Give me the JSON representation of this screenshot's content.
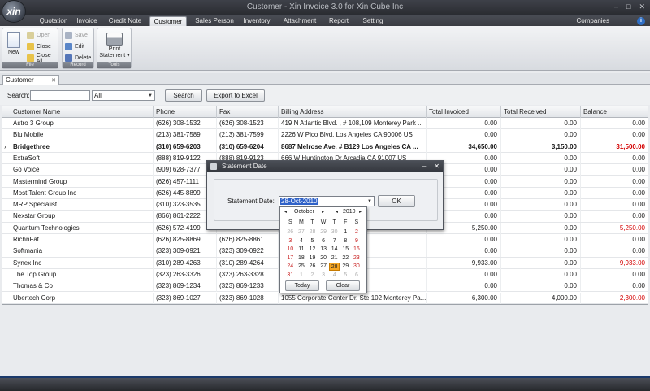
{
  "window": {
    "title": "Customer - Xin Invoice 3.0 for Xin Cube Inc",
    "app_orb_label": "xin",
    "controls": [
      "–",
      "□",
      "✕"
    ]
  },
  "ribbon_tabs": [
    "Quotation",
    "Invoice",
    "Credit Note",
    "Customer",
    "Sales Person",
    "Inventory",
    "Attachment",
    "Report",
    "Setting"
  ],
  "active_tab": "Customer",
  "companies_label": "Companies",
  "ribbon": {
    "file_group": {
      "caption": "File",
      "new": "New",
      "open": "Open",
      "close": "Close",
      "close_all": "Close All"
    },
    "record_group": {
      "caption": "Record",
      "save": "Save",
      "edit": "Edit",
      "delete": "Delete"
    },
    "tools_group": {
      "caption": "Tools",
      "print_line1": "Print",
      "print_line2": "Statement ▾"
    }
  },
  "doc_tab": {
    "label": "Customer",
    "close": "✕"
  },
  "search": {
    "label": "Search:",
    "value": "",
    "filter_value": "All",
    "search_button": "Search",
    "export_button": "Export to Excel"
  },
  "grid": {
    "columns": [
      "Customer Name",
      "Phone",
      "Fax",
      "Billing Address",
      "Total Invoiced",
      "Total Received",
      "Balance"
    ],
    "selected_indicator": "›",
    "rows": [
      {
        "name": "Astro 3 Group",
        "phone": "(626) 308-1532",
        "fax": "(626) 308-1523",
        "address": "419 N Atlantic Blvd. , # 108,109 Monterey Park ...",
        "invoiced": "0.00",
        "received": "0.00",
        "balance": "0.00",
        "neg": false
      },
      {
        "name": "Blu Mobile",
        "phone": "(213) 381-7589",
        "fax": "(213) 381-7599",
        "address": "2226 W Pico Blvd. Los Angeles CA 90006 US",
        "invoiced": "0.00",
        "received": "0.00",
        "balance": "0.00",
        "neg": false
      },
      {
        "name": "Bridgethree",
        "phone": "(310) 659-6203",
        "fax": "(310) 659-6204",
        "address": "8687 Melrose Ave. # B129 Los Angeles CA ...",
        "invoiced": "34,650.00",
        "received": "3,150.00",
        "balance": "31,500.00",
        "neg": true,
        "selected": true
      },
      {
        "name": "ExtraSoft",
        "phone": "(888) 819-9122",
        "fax": "(888) 819-9123",
        "address": "666 W Huntington Dr Arcadia CA 91007 US",
        "invoiced": "0.00",
        "received": "0.00",
        "balance": "0.00",
        "neg": false
      },
      {
        "name": "Go Voice",
        "phone": "(909) 628-7377",
        "fax": "",
        "address": "",
        "invoiced": "0.00",
        "received": "0.00",
        "balance": "0.00",
        "neg": false
      },
      {
        "name": "Mastermind Group",
        "phone": "(626) 457-1111",
        "fax": "",
        "address": "",
        "invoiced": "0.00",
        "received": "0.00",
        "balance": "0.00",
        "neg": false
      },
      {
        "name": "Most Talent Group Inc",
        "phone": "(626) 445-8899",
        "fax": "",
        "address": "",
        "invoiced": "0.00",
        "received": "0.00",
        "balance": "0.00",
        "neg": false
      },
      {
        "name": "MRP Specialist",
        "phone": "(310) 323-3535",
        "fax": "",
        "address": "",
        "invoiced": "0.00",
        "received": "0.00",
        "balance": "0.00",
        "neg": false
      },
      {
        "name": "Nexstar Group",
        "phone": "(866) 861-2222",
        "fax": "",
        "address": "",
        "invoiced": "0.00",
        "received": "0.00",
        "balance": "0.00",
        "neg": false
      },
      {
        "name": "Quantum Technologies",
        "phone": "(626) 572-4199",
        "fax": "",
        "address": "",
        "invoiced": "5,250.00",
        "received": "0.00",
        "balance": "5,250.00",
        "neg": true
      },
      {
        "name": "RichnFat",
        "phone": "(626) 825-8869",
        "fax": "(626) 825-8861",
        "address": "riel CA 91776 US",
        "invoiced": "0.00",
        "received": "0.00",
        "balance": "0.00",
        "neg": false
      },
      {
        "name": "Softmania",
        "phone": "(323) 309-0921",
        "fax": "(323) 309-0922",
        "address": "y Park, CA 91754...",
        "invoiced": "0.00",
        "received": "0.00",
        "balance": "0.00",
        "neg": false
      },
      {
        "name": "Synex Inc",
        "phone": "(310) 289-4263",
        "fax": "(310) 289-4264",
        "address": "A 91740 US",
        "invoiced": "9,933.00",
        "received": "0.00",
        "balance": "9,933.00",
        "neg": true
      },
      {
        "name": "The Top Group",
        "phone": "(323) 263-3326",
        "fax": "(323) 263-3328",
        "address": "El Monte CA, 91776 US",
        "invoiced": "0.00",
        "received": "0.00",
        "balance": "0.00",
        "neg": false
      },
      {
        "name": "Thomas & Co",
        "phone": "(323) 869-1234",
        "fax": "(323) 869-1233",
        "address": "rk CA 91755 US",
        "invoiced": "0.00",
        "received": "0.00",
        "balance": "0.00",
        "neg": false
      },
      {
        "name": "Ubertech Corp",
        "phone": "(323) 869-1027",
        "fax": "(323) 869-1028",
        "address": "1055 Corporate Center Dr. Ste 102 Monterey Pa...",
        "invoiced": "6,300.00",
        "received": "4,000.00",
        "balance": "2,300.00",
        "neg": true
      }
    ]
  },
  "dialog": {
    "title": "Statement Date",
    "controls": [
      "–",
      "✕"
    ],
    "date_label": "Statement Date:",
    "date_value": "28-Oct-2010",
    "ok_button": "OK"
  },
  "calendar": {
    "month": "October",
    "year": "2010",
    "prev": "◂",
    "next": "▸",
    "dow": [
      "S",
      "M",
      "T",
      "W",
      "T",
      "F",
      "S"
    ],
    "weeks": [
      [
        "26",
        "27",
        "28",
        "29",
        "30",
        "1",
        "2"
      ],
      [
        "3",
        "4",
        "5",
        "6",
        "7",
        "8",
        "9"
      ],
      [
        "10",
        "11",
        "12",
        "13",
        "14",
        "15",
        "16"
      ],
      [
        "17",
        "18",
        "19",
        "20",
        "21",
        "22",
        "23"
      ],
      [
        "24",
        "25",
        "26",
        "27",
        "28",
        "29",
        "30"
      ],
      [
        "31",
        "1",
        "2",
        "3",
        "4",
        "5",
        "6"
      ]
    ],
    "selected_day": "28",
    "today_button": "Today",
    "clear_button": "Clear"
  },
  "colors": {
    "negative_balance": "#d40000",
    "selection": "#f6a623",
    "accent": "#2f62c8"
  }
}
